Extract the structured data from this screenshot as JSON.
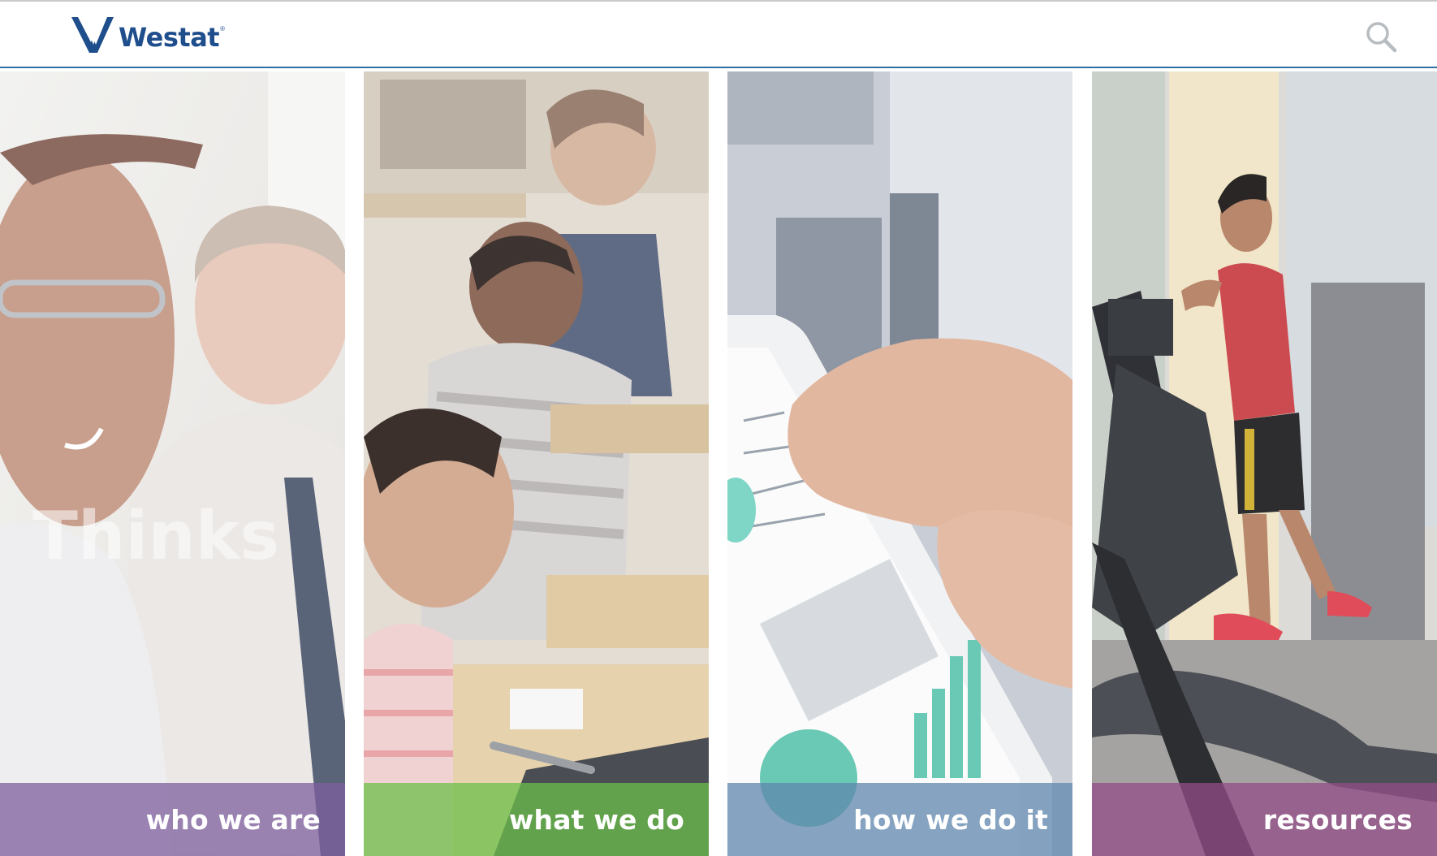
{
  "header": {
    "logo_text": "Westat",
    "logo_mark": "®",
    "search_icon": "search-icon"
  },
  "panels": [
    {
      "id": "who",
      "label": "who we are",
      "color": "#7e5f9e",
      "image": "two-colleagues-office-photo"
    },
    {
      "id": "what",
      "label": "what we do",
      "color": "#6cbf4a",
      "image": "students-classroom-laptops-photo"
    },
    {
      "id": "how",
      "label": "how we do it",
      "color": "#5f86ae",
      "image": "hands-tablet-charts-photo"
    },
    {
      "id": "resources",
      "label": "resources",
      "color": "#934c88",
      "image": "man-gym-elliptical-photo"
    }
  ],
  "photo_watermark": "Thinks",
  "colors": {
    "brand": "#1f4e8c",
    "header_border": "#2f6fa1"
  }
}
